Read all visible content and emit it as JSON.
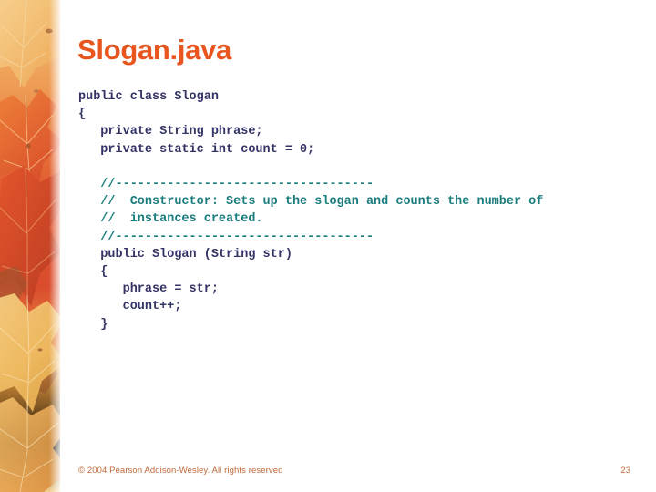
{
  "slide": {
    "title": "Slogan.java",
    "title_color": "#E8551F",
    "background_color": "#FFFFFF"
  },
  "decor": {
    "band_name": "autumn-maple-leaves-photo",
    "palette": {
      "light_yellow": "#F6D28C",
      "gold": "#F0A850",
      "orange": "#E8732E",
      "red_orange": "#D9452B",
      "deep_red": "#B8321F",
      "brown": "#8A4A2A",
      "cream": "#FAE4B8"
    }
  },
  "code": {
    "color": "#333366",
    "comment_color": "#1A7D7D",
    "lines": [
      {
        "text": "public class Slogan",
        "kind": "code"
      },
      {
        "text": "{",
        "kind": "code"
      },
      {
        "text": "   private String phrase;",
        "kind": "code"
      },
      {
        "text": "   private static int count = 0;",
        "kind": "code"
      },
      {
        "text": "",
        "kind": "blank"
      },
      {
        "text": "   //-----------------------------------",
        "kind": "comment"
      },
      {
        "text": "   //  Constructor: Sets up the slogan and counts the number of",
        "kind": "comment"
      },
      {
        "text": "   //  instances created.",
        "kind": "comment"
      },
      {
        "text": "   //-----------------------------------",
        "kind": "comment"
      },
      {
        "text": "   public Slogan (String str)",
        "kind": "code"
      },
      {
        "text": "   {",
        "kind": "code"
      },
      {
        "text": "      phrase = str;",
        "kind": "code"
      },
      {
        "text": "      count++;",
        "kind": "code"
      },
      {
        "text": "   }",
        "kind": "code"
      }
    ]
  },
  "footer": {
    "copyright": "© 2004 Pearson Addison-Wesley. All rights reserved",
    "page_number": "23",
    "color": "#C06838"
  }
}
